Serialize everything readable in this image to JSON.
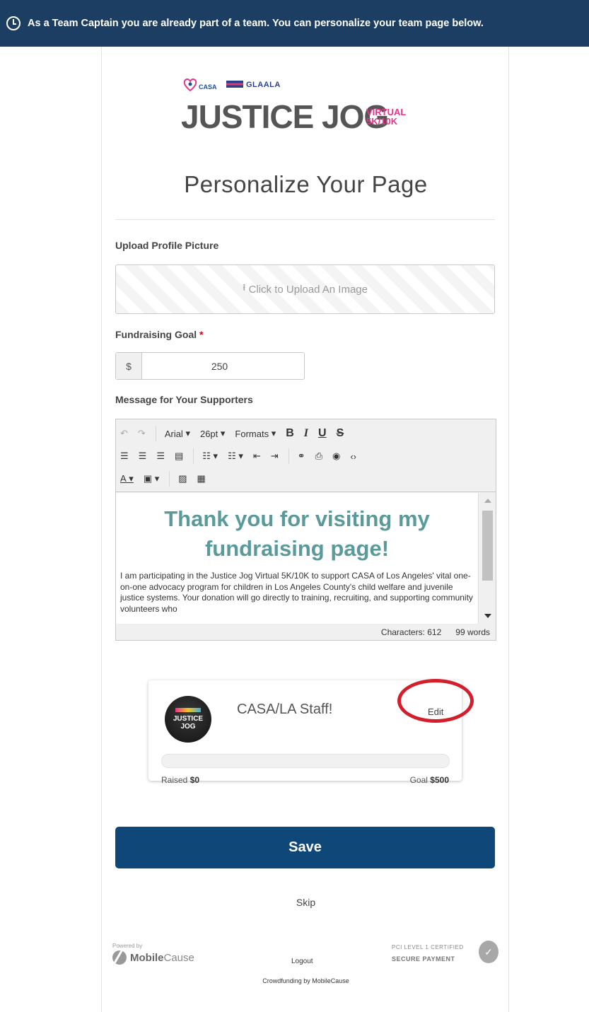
{
  "banner": {
    "text": "As a Team Captain you are already part of a team. You can personalize your team page below.",
    "color": "#1c3e63"
  },
  "logo": {
    "casa": "CASA",
    "glaala": "GLAALA",
    "event": "JUSTICE JOG",
    "virtual": "VIRTUAL",
    "distance": "5K/10K"
  },
  "page": {
    "title": "Personalize Your Page"
  },
  "upload": {
    "label": "Upload Profile Picture",
    "button_text": "Click to Upload An Image"
  },
  "goal": {
    "label": "Fundraising Goal",
    "required_mark": "*",
    "currency": "$",
    "value": "250"
  },
  "message": {
    "label": "Message for Your Supporters",
    "toolbar": {
      "font": "Arial",
      "size": "26pt",
      "formats": "Formats",
      "bold": "B",
      "italic": "I",
      "underline": "U",
      "strike": "S"
    },
    "heading": "Thank you for visiting my fundraising page!",
    "body": "I am participating in the Justice Jog Virtual 5K/10K to support CASA of Los Angeles' vital one-on-one advocacy program for children in Los Angeles County's child welfare and juvenile justice systems. Your donation will go directly to training, recruiting, and supporting community volunteers who",
    "characters": "Characters: 612",
    "words": "99 words",
    "heading_color": "#5a9a9a"
  },
  "team": {
    "name": "CASA/LA Staff!",
    "edit": "Edit",
    "avatar_text": "JUSTICE JOG",
    "raised_label": "Raised",
    "raised_value": "$0",
    "goal_label": "Goal",
    "goal_value": "$500",
    "progress_fraction": 0
  },
  "actions": {
    "save": "Save",
    "skip": "Skip",
    "save_color": "#0e4778"
  },
  "footer": {
    "powered_by": "Powered by",
    "mobilecause_a": "Mobile",
    "mobilecause_b": "Cause",
    "logout": "Logout",
    "crowdfunding": "Crowdfunding by MobileCause",
    "pci": "PCI LEVEL 1 CERTIFIED",
    "secure": "SECURE PAYMENT"
  }
}
